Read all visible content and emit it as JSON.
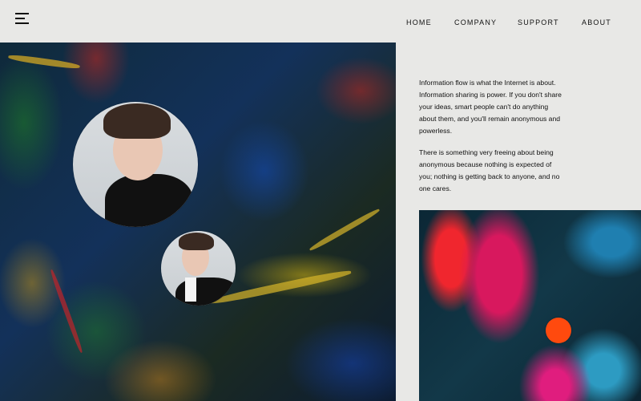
{
  "header": {
    "menu_icon": "hamburger-menu-icon",
    "nav": [
      {
        "label": "HOME"
      },
      {
        "label": "COMPANY"
      },
      {
        "label": "SUPPORT"
      },
      {
        "label": "ABOUT"
      }
    ]
  },
  "content": {
    "paragraphs": [
      "Information flow is what the Internet is about. Information sharing is power. If you don't share your ideas, smart people can't do anything about them, and you'll remain anonymous and powerless.",
      "There is something very freeing about being anonymous because nothing is expected of you; nothing is getting back to anyone, and no one cares."
    ]
  },
  "colors": {
    "background": "#e8e8e6",
    "accent_dot": "#ff4a0e",
    "text": "#111111"
  }
}
